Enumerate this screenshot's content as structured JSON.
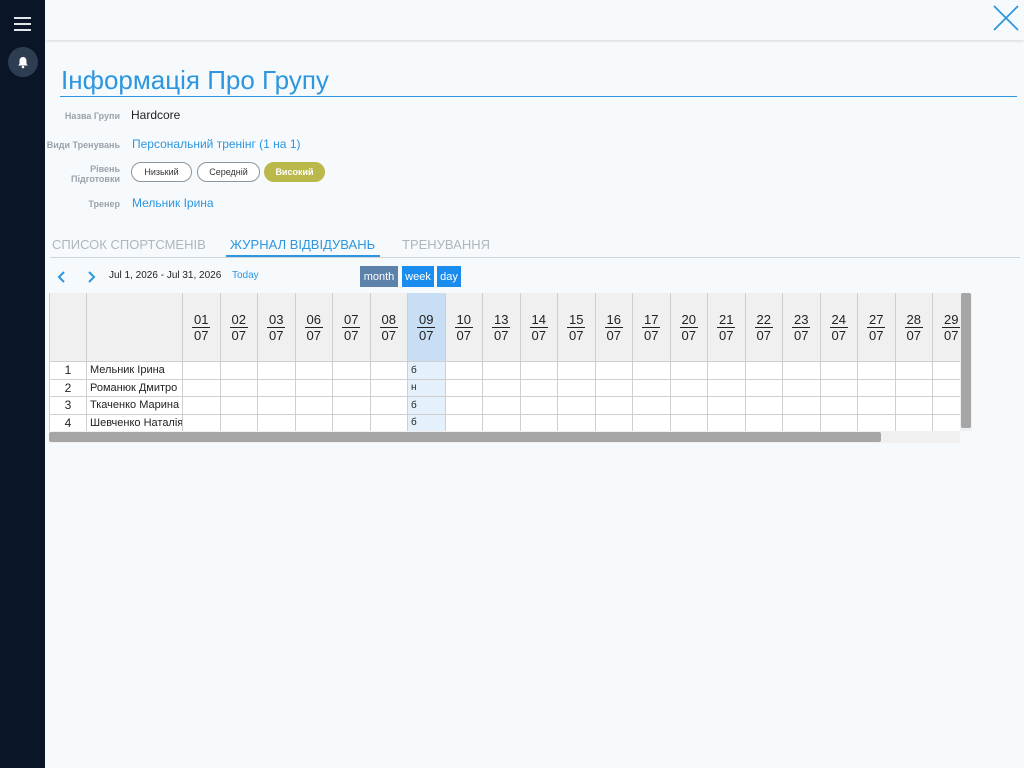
{
  "sidebar": {
    "menu_icon": "hamburger-icon",
    "notifications_icon": "bell-icon"
  },
  "topbar": {
    "close_icon": "close-icon"
  },
  "page": {
    "title": "Інформація Про Групу"
  },
  "info": {
    "group_name_label": "Назва Групи",
    "group_name": "Hardcore",
    "training_types_label": "Види Тренувань",
    "training_type": "Персональний тренінг (1 на 1)",
    "level_label": "Рівень Підготовки",
    "levels": [
      "Низький",
      "Середній",
      "Високий"
    ],
    "selected_level": "Високий",
    "coach_label": "Тренер",
    "coach": "Мельник Ірина"
  },
  "tabs": [
    "СПИСОК СПОРТСМЕНІВ",
    "ЖУРНАЛ ВІДВІДУВАНЬ",
    "ТРЕНУВАННЯ"
  ],
  "active_tab": "ЖУРНАЛ ВІДВІДУВАНЬ",
  "calendar": {
    "prev_icon": "chevron-left-icon",
    "next_icon": "chevron-right-icon",
    "date_range": "Jul 1, 2026 - Jul 31, 2026",
    "today_label": "Today",
    "views": [
      "month",
      "week",
      "day"
    ],
    "active_view": "month",
    "colors": {
      "month_active": "#5c82ab",
      "view_btn": "#1a8cf0",
      "accent": "#2d96de",
      "level_selected": "#bcb94c"
    }
  },
  "attendance": {
    "dates": [
      {
        "d": "01",
        "m": "07"
      },
      {
        "d": "02",
        "m": "07"
      },
      {
        "d": "03",
        "m": "07"
      },
      {
        "d": "06",
        "m": "07"
      },
      {
        "d": "07",
        "m": "07"
      },
      {
        "d": "08",
        "m": "07"
      },
      {
        "d": "09",
        "m": "07"
      },
      {
        "d": "10",
        "m": "07"
      },
      {
        "d": "13",
        "m": "07"
      },
      {
        "d": "14",
        "m": "07"
      },
      {
        "d": "15",
        "m": "07"
      },
      {
        "d": "16",
        "m": "07"
      },
      {
        "d": "17",
        "m": "07"
      },
      {
        "d": "20",
        "m": "07"
      },
      {
        "d": "21",
        "m": "07"
      },
      {
        "d": "22",
        "m": "07"
      },
      {
        "d": "23",
        "m": "07"
      },
      {
        "d": "24",
        "m": "07"
      },
      {
        "d": "27",
        "m": "07"
      },
      {
        "d": "28",
        "m": "07"
      },
      {
        "d": "29",
        "m": "07"
      }
    ],
    "highlight_date_index": 6,
    "rows": [
      {
        "num": "1",
        "name": "Мельник Ірина",
        "marks": {
          "6": "б"
        }
      },
      {
        "num": "2",
        "name": "Романюк Дмитро",
        "marks": {
          "6": "н"
        }
      },
      {
        "num": "3",
        "name": "Ткаченко Марина",
        "marks": {
          "6": "б"
        }
      },
      {
        "num": "4",
        "name": "Шевченко Наталія",
        "marks": {
          "6": "б"
        }
      }
    ]
  }
}
